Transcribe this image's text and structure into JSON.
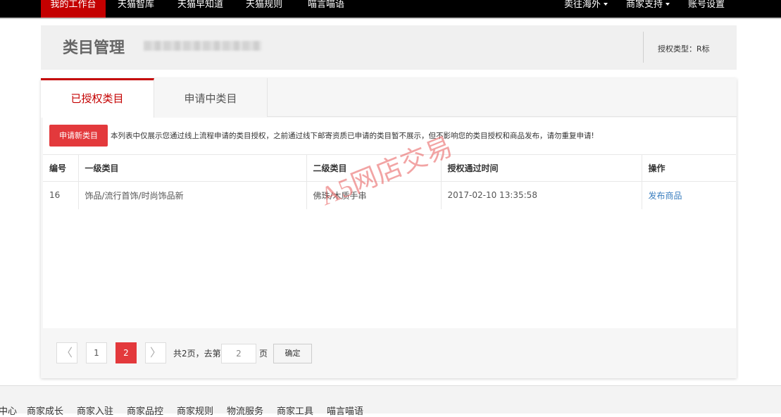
{
  "topnav": {
    "left": [
      "我的工作台",
      "天猫智库",
      "天猫早知道",
      "天猫规则",
      "喵言喵语"
    ],
    "right": [
      "卖往海外",
      "商家支持",
      "账号设置"
    ]
  },
  "header": {
    "title": "类目管理",
    "auth_type": "授权类型：R标"
  },
  "tabs": [
    "已授权类目",
    "申请中类目"
  ],
  "actions": {
    "apply_button": "申请新类目",
    "notice": "本列表中仅展示您通过线上流程申请的类目授权，之前通过线下邮寄资质已申请的类目暂不展示，但不影响您的类目授权和商品发布，请勿重复申请!"
  },
  "table": {
    "headers": [
      "编号",
      "一级类目",
      "二级类目",
      "授权通过时间",
      "操作"
    ],
    "rows": [
      {
        "id": "16",
        "level1": "饰品/流行首饰/时尚饰品新",
        "level2": "佛珠/木质手串",
        "time": "2017-02-10 13:35:58",
        "action": "发布商品"
      }
    ]
  },
  "watermark": "A5网店交易",
  "pagination": {
    "prev": "〈",
    "pages": [
      "1",
      "2"
    ],
    "current": "2",
    "next": "〉",
    "total_text": "共2页，去第",
    "page_input_value": "2",
    "page_suffix": "页",
    "confirm": "确定"
  },
  "footer": [
    "中心",
    "商家成长",
    "商家入驻",
    "商家品控",
    "商家规则",
    "物流服务",
    "商家工具",
    "喵言喵语"
  ],
  "colors": {
    "accent_red": "#c40000",
    "button_red": "#e3393c",
    "link_blue": "#3a7ebf"
  }
}
